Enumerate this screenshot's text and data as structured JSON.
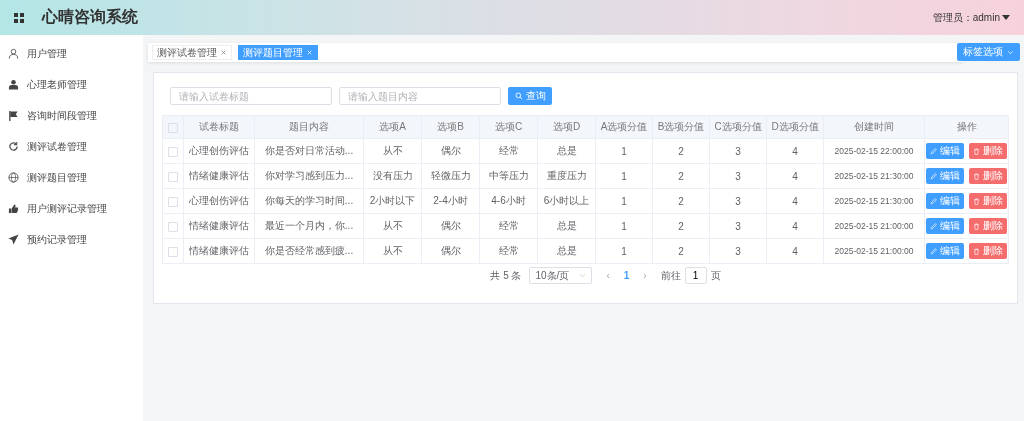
{
  "header": {
    "title": "心晴咨询系统",
    "user": "管理员：admin"
  },
  "sidebar": {
    "items": [
      {
        "label": "用户管理"
      },
      {
        "label": "心理老师管理"
      },
      {
        "label": "咨询时间段管理"
      },
      {
        "label": "测评试卷管理"
      },
      {
        "label": "测评题目管理"
      },
      {
        "label": "用户测评记录管理"
      },
      {
        "label": "预约记录管理"
      }
    ]
  },
  "tabs": [
    {
      "label": "测评试卷管理",
      "selected": false
    },
    {
      "label": "测评题目管理",
      "selected": true
    }
  ],
  "tab_options": "标签选项",
  "filters": [
    {
      "placeholder": "请输入试卷标题"
    },
    {
      "placeholder": "请输入题目内容"
    }
  ],
  "search_button": "查询",
  "table": {
    "header_checked": false,
    "columns": [
      "试卷标题",
      "题目内容",
      "选项A",
      "选项B",
      "选项C",
      "选项D",
      "A选项分值",
      "B选项分值",
      "C选项分值",
      "D选项分值",
      "创建时间",
      "操作"
    ],
    "rows": [
      {
        "checked": false,
        "cells": [
          "心理创伤评估",
          "你是否对日常活动...",
          "从不",
          "偶尔",
          "经常",
          "总是",
          "1",
          "2",
          "3",
          "4",
          "2025-02-15 22:00:00"
        ],
        "actions": [
          {
            "label": "编辑",
            "kind": "edit"
          },
          {
            "label": "删除",
            "kind": "delete"
          }
        ]
      },
      {
        "checked": false,
        "cells": [
          "情绪健康评估",
          "你对学习感到压力...",
          "没有压力",
          "轻微压力",
          "中等压力",
          "重度压力",
          "1",
          "2",
          "3",
          "4",
          "2025-02-15 21:30:00"
        ],
        "actions": [
          {
            "label": "编辑",
            "kind": "edit"
          },
          {
            "label": "删除",
            "kind": "delete"
          }
        ]
      },
      {
        "checked": false,
        "cells": [
          "心理创伤评估",
          "你每天的学习时间...",
          "2小时以下",
          "2-4小时",
          "4-6小时",
          "6小时以上",
          "1",
          "2",
          "3",
          "4",
          "2025-02-15 21:30:00"
        ],
        "actions": [
          {
            "label": "编辑",
            "kind": "edit"
          },
          {
            "label": "删除",
            "kind": "delete"
          }
        ]
      },
      {
        "checked": false,
        "cells": [
          "情绪健康评估",
          "最近一个月内，你...",
          "从不",
          "偶尔",
          "经常",
          "总是",
          "1",
          "2",
          "3",
          "4",
          "2025-02-15 21:00:00"
        ],
        "actions": [
          {
            "label": "编辑",
            "kind": "edit"
          },
          {
            "label": "删除",
            "kind": "delete"
          }
        ]
      },
      {
        "checked": false,
        "cells": [
          "情绪健康评估",
          "你是否经常感到疲...",
          "从不",
          "偶尔",
          "经常",
          "总是",
          "1",
          "2",
          "3",
          "4",
          "2025-02-15 21:00:00"
        ],
        "actions": [
          {
            "label": "编辑",
            "kind": "edit"
          },
          {
            "label": "删除",
            "kind": "delete"
          }
        ]
      }
    ]
  },
  "pagination": {
    "total": "共 5 条",
    "page_size": "10条/页",
    "prev": "‹",
    "pages": [
      {
        "label": "1",
        "selected": true
      }
    ],
    "next": "›",
    "goto_label": "前往",
    "goto_value": "1",
    "goto_suffix": "页"
  }
}
